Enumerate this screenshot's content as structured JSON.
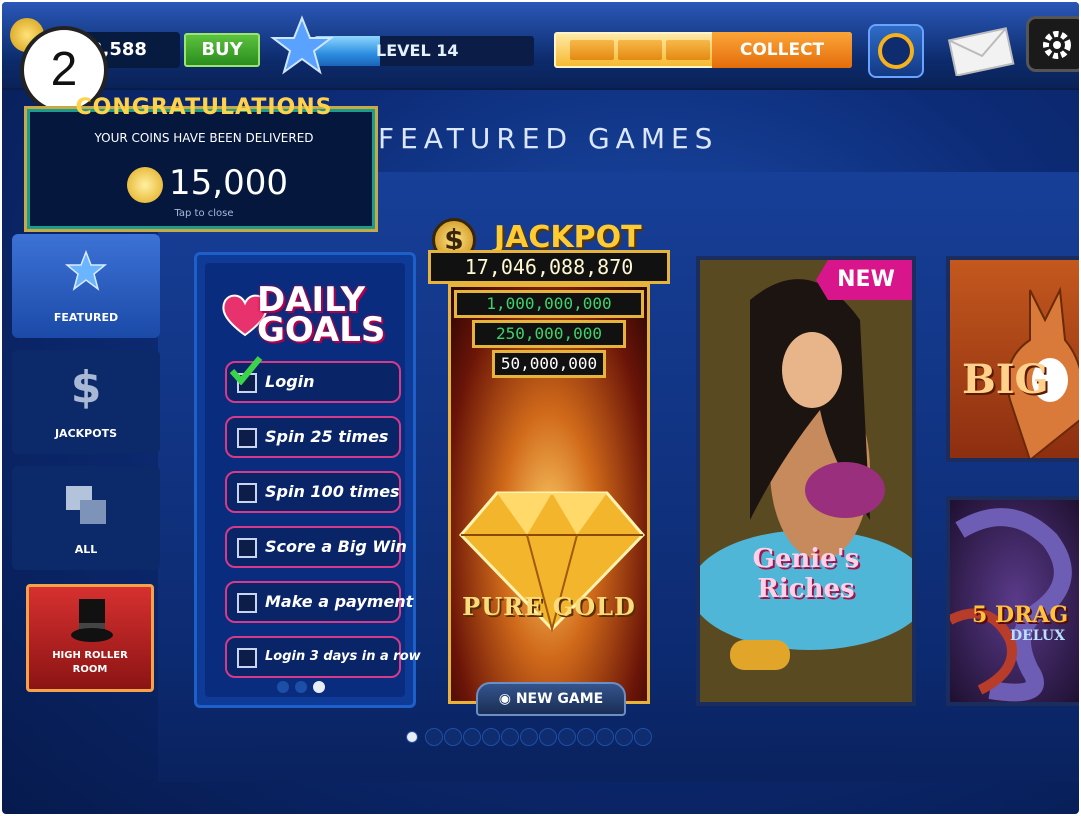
{
  "step_number": "2",
  "topbar": {
    "coins": "3,588",
    "buy_label": "BUY",
    "level_label": "LEVEL 14",
    "level_progress": 0.3,
    "collect_label": "COLLECT",
    "icons": [
      "coin-icon",
      "star-icon",
      "bonus-wheel-icon",
      "mail-icon",
      "settings-gear-icon"
    ]
  },
  "congrats": {
    "title": "CONGRATULATIONS",
    "subtitle": "YOUR COINS HAVE BEEN DELIVERED",
    "amount": "15,000",
    "tap_hint": "Tap to close"
  },
  "section_title": "FEATURED GAMES",
  "sidebar": {
    "items": [
      {
        "label": "FEATURED",
        "icon": "star-icon",
        "active": true
      },
      {
        "label": "JACKPOTS",
        "icon": "dollar-icon",
        "active": false
      },
      {
        "label": "ALL",
        "icon": "squares-icon",
        "active": false
      }
    ],
    "high_roller": {
      "line1": "HIGH ROLLER",
      "line2": "ROOM",
      "icon": "top-hat-icon"
    }
  },
  "daily_goals": {
    "title_line1": "DAILY",
    "title_line2": "GOALS",
    "goals": [
      {
        "label": "Login",
        "done": true
      },
      {
        "label": "Spin 25 times",
        "done": false
      },
      {
        "label": "Spin 100 times",
        "done": false
      },
      {
        "label": "Score a Big Win",
        "done": false
      },
      {
        "label": "Make a payment",
        "done": false
      },
      {
        "label": "Login 3 days in a row",
        "done": false
      }
    ]
  },
  "jackpot_card": {
    "symbol": "$",
    "title": "JACKPOT",
    "amount": "17,046,088,870",
    "tiers": [
      "1,000,000,000",
      "250,000,000",
      "50,000,000"
    ],
    "tier_colors": [
      "#3bd36a",
      "#3bd36a",
      "#ffffff"
    ],
    "game_name": "PURE GOLD",
    "badge": "NEW GAME"
  },
  "genie_card": {
    "badge": "NEW",
    "game_name": "Genie's Riches"
  },
  "kangaroo_card": {
    "text": "BIG"
  },
  "dragon_card": {
    "text": "5 DRAG",
    "sub": "DELUX"
  }
}
